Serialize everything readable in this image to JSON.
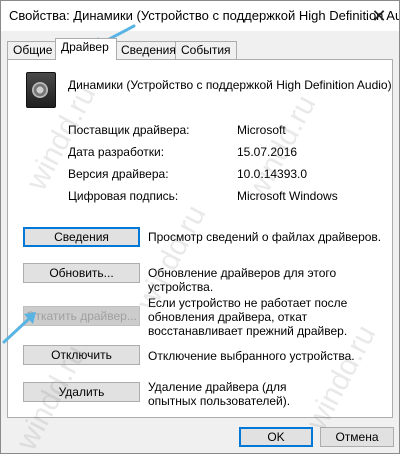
{
  "window": {
    "title": "Свойства: Динамики (Устройство с поддержкой High Definition Audio)"
  },
  "tabs": [
    {
      "label": "Общие"
    },
    {
      "label": "Драйвер"
    },
    {
      "label": "Сведения"
    },
    {
      "label": "События"
    }
  ],
  "device": {
    "name": "Динамики (Устройство с поддержкой High Definition Audio)",
    "icon": "speaker-icon"
  },
  "info": [
    {
      "label": "Поставщик драйвера:",
      "value": "Microsoft"
    },
    {
      "label": "Дата разработки:",
      "value": "15.07.2016"
    },
    {
      "label": "Версия драйвера:",
      "value": "10.0.14393.0"
    },
    {
      "label": "Цифровая подпись:",
      "value": "Microsoft Windows"
    }
  ],
  "actions": [
    {
      "label": "Сведения",
      "desc": "Просмотр сведений о файлах драйверов."
    },
    {
      "label": "Обновить...",
      "desc": "Обновление драйверов для этого устройства."
    },
    {
      "label": "Откатить драйвер...",
      "desc": "Если устройство не работает после обновления драйвера, откат восстанавливает прежний драйвер."
    },
    {
      "label": "Отключить",
      "desc": "Отключение выбранного устройства."
    },
    {
      "label": "Удалить",
      "desc": "Удаление драйвера (для опытных пользователей)."
    }
  ],
  "footer": {
    "ok": "OK",
    "cancel": "Отмена"
  },
  "watermark": "windd.ru",
  "colors": {
    "accent": "#0078d7",
    "arrow": "#59b4e3"
  }
}
